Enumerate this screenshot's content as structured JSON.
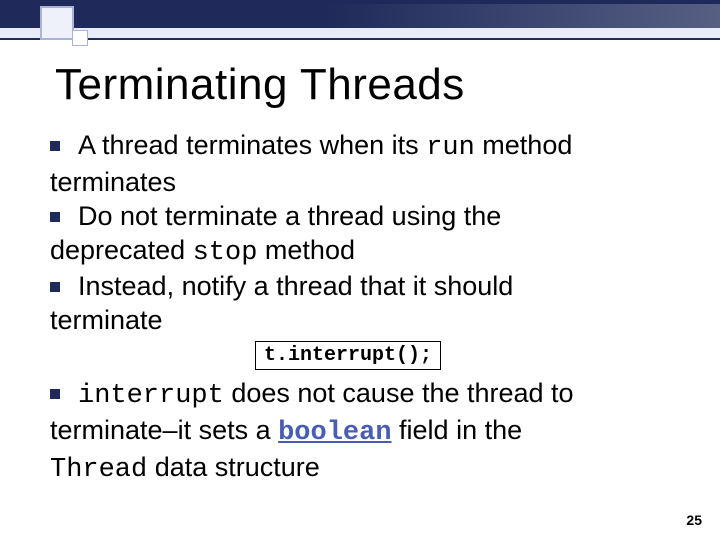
{
  "title": "Terminating Threads",
  "bullets": {
    "b1_pre": "A thread terminates when its ",
    "b1_code": "run",
    "b1_post": " method",
    "b1_cont": "terminates",
    "b2_line": "Do not terminate a thread using the",
    "b2_cont_pre": "deprecated ",
    "b2_cont_code": "stop",
    "b2_cont_post": " method",
    "b3_line": "Instead, notify a thread that it should",
    "b3_cont": "terminate"
  },
  "code_box": "t.interrupt();",
  "lower": {
    "l1_code": "interrupt",
    "l1_post": " does not cause the thread to",
    "l2_pre": "terminate–it sets a ",
    "l2_bool": "boolean",
    "l2_post": " field in the",
    "l3_code": "Thread",
    "l3_post": " data structure"
  },
  "page_number": "25"
}
